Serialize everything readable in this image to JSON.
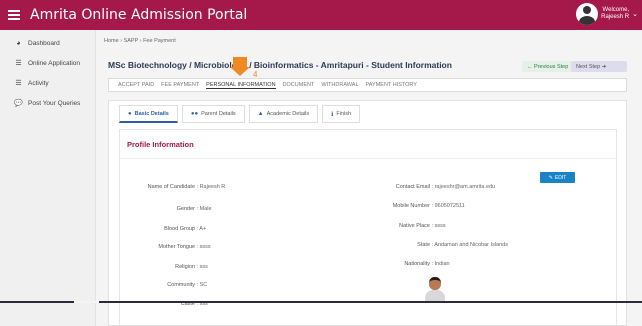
{
  "header": {
    "title": "Amrita Online Admission Portal",
    "welcome": "Welcome,",
    "user_name": "Rajeesh R",
    "brand_color": "#a5184a"
  },
  "sidebar": {
    "items": [
      {
        "label": "Dashboard",
        "icon": "dashboard-gauge-icon"
      },
      {
        "label": "Online Application",
        "icon": "list-icon"
      },
      {
        "label": "Activity",
        "icon": "list-icon"
      },
      {
        "label": "Post Your Queries",
        "icon": "chat-bubble-icon"
      }
    ]
  },
  "breadcrumb": {
    "home": "Home",
    "sep1": "›",
    "item1": "SAPP",
    "sep2": "›",
    "item2": "Fee Payment"
  },
  "page": {
    "title": "MSc Biotechnology / Microbiology / Bioinformatics - Amritapuri - Student Information",
    "prev_step": "← Previous Step",
    "next_step": "Next Step ➜"
  },
  "steps": [
    {
      "label": "ACCEPT PAID",
      "active": false
    },
    {
      "label": "FEE PAYMENT",
      "active": false
    },
    {
      "label": "PERSONAL INFORMATION",
      "active": true
    },
    {
      "label": "DOCUMENT",
      "active": false
    },
    {
      "label": "WITHDRAWAL",
      "active": false
    },
    {
      "label": "PAYMENT HISTORY",
      "active": false
    }
  ],
  "annotation": {
    "number": "4",
    "color": "#f08a24"
  },
  "subtabs": [
    {
      "label": "Basic Details",
      "icon": "user-icon",
      "active": true
    },
    {
      "label": "Parent Details",
      "icon": "users-icon",
      "active": false
    },
    {
      "label": "Academic Details",
      "icon": "graduation-cap-icon",
      "active": false
    },
    {
      "label": "Finish",
      "icon": "info-icon",
      "active": false
    }
  ],
  "profile": {
    "title": "Profile Information",
    "edit_label": "EDIT",
    "left_fields": [
      {
        "label": "Name of Candidate",
        "value": ": Rajeesh R"
      },
      {
        "label": "Gender",
        "value": ": Male"
      },
      {
        "label": "Blood Group",
        "value": ": A+"
      },
      {
        "label": "Mother Tongue",
        "value": ": ssss"
      },
      {
        "label": "Religion",
        "value": ": sss"
      },
      {
        "label": "Community",
        "value": ": SC"
      },
      {
        "label": "Caste",
        "value": ": sss"
      }
    ],
    "right_fields": [
      {
        "label": "Contact Email",
        "value": ": rajeeshr@am.amrita.edu"
      },
      {
        "label": "Mobile Number",
        "value": ": 9605072511"
      },
      {
        "label": "Native Place",
        "value": ": ssss"
      },
      {
        "label": "State",
        "value": ": Andaman and Nicobar Islands"
      },
      {
        "label": "Nationality",
        "value": ": Indian"
      }
    ]
  }
}
